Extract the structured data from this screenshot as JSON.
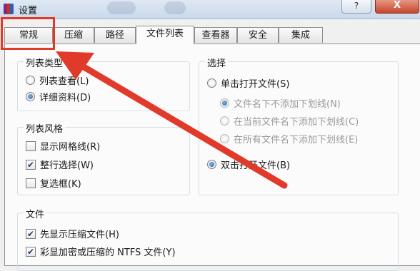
{
  "window": {
    "title": "设置",
    "help_label": "?",
    "close_label": "X"
  },
  "tabs": [
    {
      "label": "常规",
      "active": false
    },
    {
      "label": "压缩",
      "active": false
    },
    {
      "label": "路径",
      "active": false
    },
    {
      "label": "文件列表",
      "active": true
    },
    {
      "label": "查看器",
      "active": false
    },
    {
      "label": "安全",
      "active": false
    },
    {
      "label": "集成",
      "active": false
    }
  ],
  "list_type": {
    "title": "列表类型",
    "options": [
      {
        "label": "列表查看(L)",
        "selected": false
      },
      {
        "label": "详细资料(D)",
        "selected": true
      }
    ]
  },
  "list_style": {
    "title": "列表风格",
    "options": [
      {
        "label": "显示网格线(R)",
        "checked": false
      },
      {
        "label": "整行选择(W)",
        "checked": true
      },
      {
        "label": "复选框(K)",
        "checked": false
      }
    ]
  },
  "selection": {
    "title": "选择",
    "single_click": {
      "label": "单击打开文件(S)",
      "selected": false
    },
    "underline_options": [
      {
        "label": "文件名下不添加下划线(N)",
        "selected": true,
        "disabled": true
      },
      {
        "label": "在当前文件名下添加下划线(C)",
        "selected": false,
        "disabled": true
      },
      {
        "label": "在所有文件名下添加下划线(E)",
        "selected": false,
        "disabled": true
      }
    ],
    "double_click": {
      "label": "双击打开文件(B)",
      "selected": true
    }
  },
  "files": {
    "title": "文件",
    "options": [
      {
        "label": "先显示压缩文件(H)",
        "checked": true
      },
      {
        "label": "彩显加密或压缩的 NTFS 文件(Y)",
        "checked": true
      }
    ]
  },
  "annotation": {
    "color": "#e23a2a"
  }
}
